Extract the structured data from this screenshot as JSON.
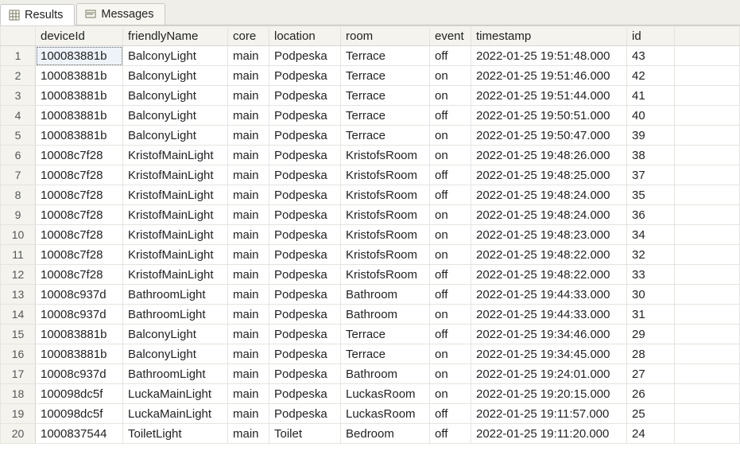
{
  "tabs": {
    "results": "Results",
    "messages": "Messages"
  },
  "columns": [
    "deviceId",
    "friendlyName",
    "core",
    "location",
    "room",
    "event",
    "timestamp",
    "id"
  ],
  "rows": [
    {
      "n": "1",
      "deviceId": "100083881b",
      "friendlyName": "BalconyLight",
      "core": "main",
      "location": "Podpeska",
      "room": "Terrace",
      "event": "off",
      "timestamp": "2022-01-25 19:51:48.000",
      "id": "43"
    },
    {
      "n": "2",
      "deviceId": "100083881b",
      "friendlyName": "BalconyLight",
      "core": "main",
      "location": "Podpeska",
      "room": "Terrace",
      "event": "on",
      "timestamp": "2022-01-25 19:51:46.000",
      "id": "42"
    },
    {
      "n": "3",
      "deviceId": "100083881b",
      "friendlyName": "BalconyLight",
      "core": "main",
      "location": "Podpeska",
      "room": "Terrace",
      "event": "on",
      "timestamp": "2022-01-25 19:51:44.000",
      "id": "41"
    },
    {
      "n": "4",
      "deviceId": "100083881b",
      "friendlyName": "BalconyLight",
      "core": "main",
      "location": "Podpeska",
      "room": "Terrace",
      "event": "off",
      "timestamp": "2022-01-25 19:50:51.000",
      "id": "40"
    },
    {
      "n": "5",
      "deviceId": "100083881b",
      "friendlyName": "BalconyLight",
      "core": "main",
      "location": "Podpeska",
      "room": "Terrace",
      "event": "on",
      "timestamp": "2022-01-25 19:50:47.000",
      "id": "39"
    },
    {
      "n": "6",
      "deviceId": "10008c7f28",
      "friendlyName": "KristofMainLight",
      "core": "main",
      "location": "Podpeska",
      "room": "KristofsRoom",
      "event": "on",
      "timestamp": "2022-01-25 19:48:26.000",
      "id": "38"
    },
    {
      "n": "7",
      "deviceId": "10008c7f28",
      "friendlyName": "KristofMainLight",
      "core": "main",
      "location": "Podpeska",
      "room": "KristofsRoom",
      "event": "off",
      "timestamp": "2022-01-25 19:48:25.000",
      "id": "37"
    },
    {
      "n": "8",
      "deviceId": "10008c7f28",
      "friendlyName": "KristofMainLight",
      "core": "main",
      "location": "Podpeska",
      "room": "KristofsRoom",
      "event": "off",
      "timestamp": "2022-01-25 19:48:24.000",
      "id": "35"
    },
    {
      "n": "9",
      "deviceId": "10008c7f28",
      "friendlyName": "KristofMainLight",
      "core": "main",
      "location": "Podpeska",
      "room": "KristofsRoom",
      "event": "on",
      "timestamp": "2022-01-25 19:48:24.000",
      "id": "36"
    },
    {
      "n": "10",
      "deviceId": "10008c7f28",
      "friendlyName": "KristofMainLight",
      "core": "main",
      "location": "Podpeska",
      "room": "KristofsRoom",
      "event": "on",
      "timestamp": "2022-01-25 19:48:23.000",
      "id": "34"
    },
    {
      "n": "11",
      "deviceId": "10008c7f28",
      "friendlyName": "KristofMainLight",
      "core": "main",
      "location": "Podpeska",
      "room": "KristofsRoom",
      "event": "on",
      "timestamp": "2022-01-25 19:48:22.000",
      "id": "32"
    },
    {
      "n": "12",
      "deviceId": "10008c7f28",
      "friendlyName": "KristofMainLight",
      "core": "main",
      "location": "Podpeska",
      "room": "KristofsRoom",
      "event": "off",
      "timestamp": "2022-01-25 19:48:22.000",
      "id": "33"
    },
    {
      "n": "13",
      "deviceId": "10008c937d",
      "friendlyName": "BathroomLight",
      "core": "main",
      "location": "Podpeska",
      "room": "Bathroom",
      "event": "off",
      "timestamp": "2022-01-25 19:44:33.000",
      "id": "30"
    },
    {
      "n": "14",
      "deviceId": "10008c937d",
      "friendlyName": "BathroomLight",
      "core": "main",
      "location": "Podpeska",
      "room": "Bathroom",
      "event": "on",
      "timestamp": "2022-01-25 19:44:33.000",
      "id": "31"
    },
    {
      "n": "15",
      "deviceId": "100083881b",
      "friendlyName": "BalconyLight",
      "core": "main",
      "location": "Podpeska",
      "room": "Terrace",
      "event": "off",
      "timestamp": "2022-01-25 19:34:46.000",
      "id": "29"
    },
    {
      "n": "16",
      "deviceId": "100083881b",
      "friendlyName": "BalconyLight",
      "core": "main",
      "location": "Podpeska",
      "room": "Terrace",
      "event": "on",
      "timestamp": "2022-01-25 19:34:45.000",
      "id": "28"
    },
    {
      "n": "17",
      "deviceId": "10008c937d",
      "friendlyName": "BathroomLight",
      "core": "main",
      "location": "Podpeska",
      "room": "Bathroom",
      "event": "on",
      "timestamp": "2022-01-25 19:24:01.000",
      "id": "27"
    },
    {
      "n": "18",
      "deviceId": "100098dc5f",
      "friendlyName": "LuckaMainLight",
      "core": "main",
      "location": "Podpeska",
      "room": "LuckasRoom",
      "event": "on",
      "timestamp": "2022-01-25 19:20:15.000",
      "id": "26"
    },
    {
      "n": "19",
      "deviceId": "100098dc5f",
      "friendlyName": "LuckaMainLight",
      "core": "main",
      "location": "Podpeska",
      "room": "LuckasRoom",
      "event": "off",
      "timestamp": "2022-01-25 19:11:57.000",
      "id": "25"
    },
    {
      "n": "20",
      "deviceId": "1000837544",
      "friendlyName": "ToiletLight",
      "core": "main",
      "location": "Toilet",
      "room": "Bedroom",
      "event": "off",
      "timestamp": "2022-01-25 19:11:20.000",
      "id": "24"
    }
  ]
}
